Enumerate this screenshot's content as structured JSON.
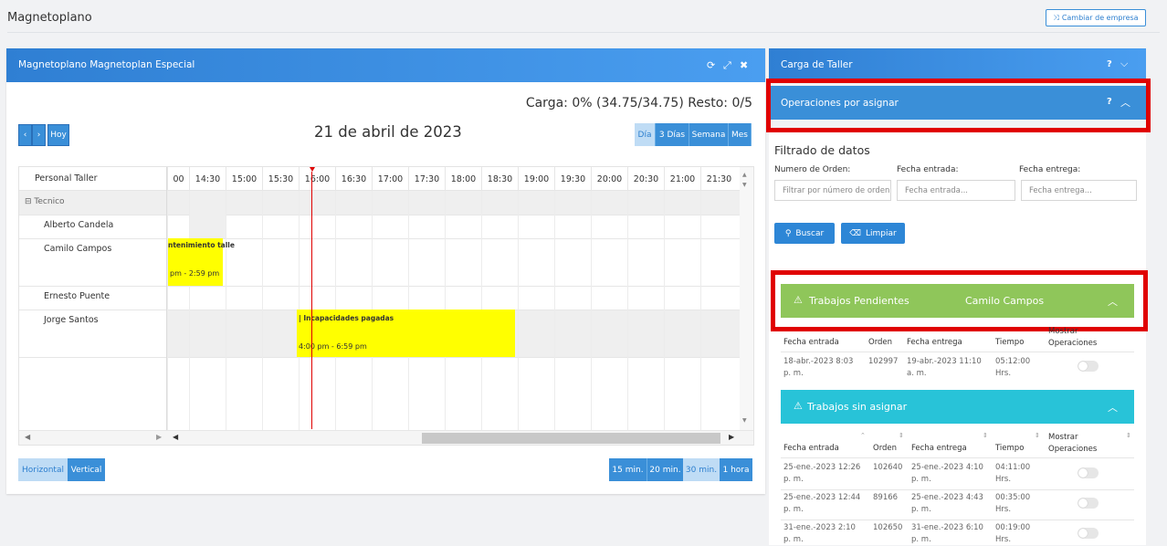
{
  "app": {
    "title": "Magnetoplano",
    "change_company": "Cambiar de empresa"
  },
  "left": {
    "title": "Magnetoplano Magnetoplan Especial",
    "load_text": "Carga: 0% (34.75/34.75) Resto: 0/5",
    "today": "Hoy",
    "date_title": "21 de abril de 2023",
    "views": [
      "Día",
      "3 Días",
      "Semana",
      "Mes"
    ],
    "grid": {
      "resource_header": "Personal Taller",
      "group": "Tecnico",
      "people": [
        "Alberto Candela",
        "Camilo Campos",
        "Ernesto Puente",
        "Jorge Santos"
      ],
      "times": [
        "00",
        "14:30",
        "15:00",
        "15:30",
        "16:00",
        "16:30",
        "17:00",
        "17:30",
        "18:00",
        "18:30",
        "19:00",
        "19:30",
        "20:00",
        "20:30",
        "21:00",
        "21:30"
      ],
      "events": [
        {
          "title": "ntenimiento talle",
          "time": "pm - 2:59 pm"
        },
        {
          "title": "| Incapacidades pagadas",
          "time": "4:00 pm - 6:59 pm"
        }
      ]
    },
    "orientation": [
      "Horizontal",
      "Vertical"
    ],
    "intervals": [
      "15 min.",
      "20 min.",
      "30 min.",
      "1 hora"
    ]
  },
  "right": {
    "carga_taller": "Carga de Taller",
    "ops": "Operaciones por asignar",
    "filter_title": "Filtrado de datos",
    "labels": {
      "order": "Numero de Orden:",
      "entry": "Fecha entrada:",
      "delivery": "Fecha entrega:"
    },
    "placeholders": {
      "order": "Filtrar por número de orden",
      "entry": "Fecha entrada...",
      "delivery": "Fecha entrega..."
    },
    "search": "Buscar",
    "clear": "Limpiar",
    "pending": {
      "title": "Trabajos Pendientes",
      "person": "Camilo Campos",
      "headers": {
        "entry": "Fecha entrada",
        "order": "Orden",
        "delivery": "Fecha entrega",
        "time": "Tiempo",
        "show": "Mostrar Operaciones"
      },
      "rows": [
        {
          "entry": "18-abr.-2023 8:03 p. m.",
          "order": "102997",
          "delivery": "19-abr.-2023 11:10 a. m.",
          "time": "05:12:00 Hrs."
        }
      ]
    },
    "unassigned": {
      "title": "Trabajos sin asignar",
      "headers": {
        "entry": "Fecha entrada",
        "order": "Orden",
        "delivery": "Fecha entrega",
        "time": "Tiempo",
        "show": "Mostrar Operaciones"
      },
      "rows": [
        {
          "entry": "25-ene.-2023 12:26 p. m.",
          "order": "102640",
          "delivery": "25-ene.-2023 4:10 p. m.",
          "time": "04:11:00 Hrs."
        },
        {
          "entry": "25-ene.-2023 12:44 p. m.",
          "order": "89166",
          "delivery": "25-ene.-2023 4:43 p. m.",
          "time": "00:35:00 Hrs."
        },
        {
          "entry": "31-ene.-2023 2:10 p. m.",
          "order": "102650",
          "delivery": "31-ene.-2023 6:10 p. m.",
          "time": "00:19:00 Hrs."
        }
      ]
    }
  },
  "colors": {
    "primary": "#3a8fd8",
    "green": "#8fc65a",
    "cyan": "#28c3d8",
    "highlight": "#e00000",
    "event": "#ffff00"
  }
}
